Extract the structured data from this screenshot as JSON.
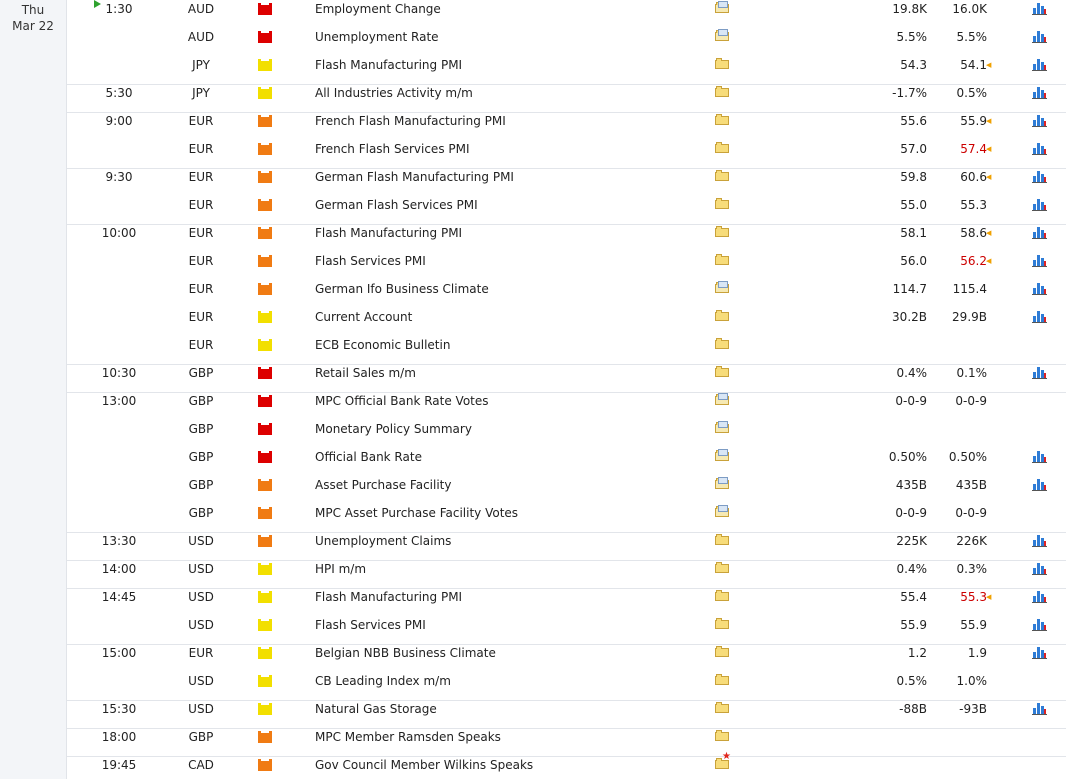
{
  "date": {
    "day": "Thu",
    "date": "Mar 22"
  },
  "rows": [
    {
      "time": "1:30",
      "currency": "AUD",
      "impact": "high",
      "event": "Employment Change",
      "detail": "note",
      "actual": "19.8K",
      "forecast": "16.0K",
      "forecast_revised": false,
      "arrow": "",
      "graph": true,
      "sep": false,
      "current": true
    },
    {
      "time": "",
      "currency": "AUD",
      "impact": "high",
      "event": "Unemployment Rate",
      "detail": "note",
      "actual": "5.5%",
      "forecast": "5.5%",
      "forecast_revised": false,
      "arrow": "",
      "graph": true,
      "sep": false
    },
    {
      "time": "",
      "currency": "JPY",
      "impact": "low",
      "event": "Flash Manufacturing PMI",
      "detail": "plain",
      "actual": "54.3",
      "forecast": "54.1",
      "forecast_revised": false,
      "arrow": "◀",
      "graph": true,
      "sep": false
    },
    {
      "time": "5:30",
      "currency": "JPY",
      "impact": "low",
      "event": "All Industries Activity m/m",
      "detail": "plain",
      "actual": "-1.7%",
      "forecast": "0.5%",
      "forecast_revised": false,
      "arrow": "",
      "graph": true,
      "sep": true
    },
    {
      "time": "9:00",
      "currency": "EUR",
      "impact": "medium",
      "event": "French Flash Manufacturing PMI",
      "detail": "plain",
      "actual": "55.6",
      "forecast": "55.9",
      "forecast_revised": false,
      "arrow": "◀",
      "graph": true,
      "sep": true
    },
    {
      "time": "",
      "currency": "EUR",
      "impact": "medium",
      "event": "French Flash Services PMI",
      "detail": "plain",
      "actual": "57.0",
      "forecast": "57.4",
      "forecast_revised": true,
      "arrow": "◀",
      "graph": true,
      "sep": false
    },
    {
      "time": "9:30",
      "currency": "EUR",
      "impact": "medium",
      "event": "German Flash Manufacturing PMI",
      "detail": "plain",
      "actual": "59.8",
      "forecast": "60.6",
      "forecast_revised": false,
      "arrow": "◀",
      "graph": true,
      "sep": true
    },
    {
      "time": "",
      "currency": "EUR",
      "impact": "medium",
      "event": "German Flash Services PMI",
      "detail": "plain",
      "actual": "55.0",
      "forecast": "55.3",
      "forecast_revised": false,
      "arrow": "",
      "graph": true,
      "sep": false
    },
    {
      "time": "10:00",
      "currency": "EUR",
      "impact": "medium",
      "event": "Flash Manufacturing PMI",
      "detail": "plain",
      "actual": "58.1",
      "forecast": "58.6",
      "forecast_revised": false,
      "arrow": "◀",
      "graph": true,
      "sep": true
    },
    {
      "time": "",
      "currency": "EUR",
      "impact": "medium",
      "event": "Flash Services PMI",
      "detail": "plain",
      "actual": "56.0",
      "forecast": "56.2",
      "forecast_revised": true,
      "arrow": "◀",
      "graph": true,
      "sep": false
    },
    {
      "time": "",
      "currency": "EUR",
      "impact": "medium",
      "event": "German Ifo Business Climate",
      "detail": "note",
      "actual": "114.7",
      "forecast": "115.4",
      "forecast_revised": false,
      "arrow": "",
      "graph": true,
      "sep": false
    },
    {
      "time": "",
      "currency": "EUR",
      "impact": "low",
      "event": "Current Account",
      "detail": "plain",
      "actual": "30.2B",
      "forecast": "29.9B",
      "forecast_revised": false,
      "arrow": "",
      "graph": true,
      "sep": false
    },
    {
      "time": "",
      "currency": "EUR",
      "impact": "low",
      "event": "ECB Economic Bulletin",
      "detail": "plain",
      "actual": "",
      "forecast": "",
      "forecast_revised": false,
      "arrow": "",
      "graph": false,
      "sep": false
    },
    {
      "time": "10:30",
      "currency": "GBP",
      "impact": "high",
      "event": "Retail Sales m/m",
      "detail": "plain",
      "actual": "0.4%",
      "forecast": "0.1%",
      "forecast_revised": false,
      "arrow": "",
      "graph": true,
      "sep": true
    },
    {
      "time": "13:00",
      "currency": "GBP",
      "impact": "high",
      "event": "MPC Official Bank Rate Votes",
      "detail": "note",
      "actual": "0-0-9",
      "forecast": "0-0-9",
      "forecast_revised": false,
      "arrow": "",
      "graph": false,
      "sep": true
    },
    {
      "time": "",
      "currency": "GBP",
      "impact": "high",
      "event": "Monetary Policy Summary",
      "detail": "note",
      "actual": "",
      "forecast": "",
      "forecast_revised": false,
      "arrow": "",
      "graph": false,
      "sep": false
    },
    {
      "time": "",
      "currency": "GBP",
      "impact": "high",
      "event": "Official Bank Rate",
      "detail": "note",
      "actual": "0.50%",
      "forecast": "0.50%",
      "forecast_revised": false,
      "arrow": "",
      "graph": true,
      "sep": false
    },
    {
      "time": "",
      "currency": "GBP",
      "impact": "medium",
      "event": "Asset Purchase Facility",
      "detail": "note",
      "actual": "435B",
      "forecast": "435B",
      "forecast_revised": false,
      "arrow": "",
      "graph": true,
      "sep": false
    },
    {
      "time": "",
      "currency": "GBP",
      "impact": "medium",
      "event": "MPC Asset Purchase Facility Votes",
      "detail": "note",
      "actual": "0-0-9",
      "forecast": "0-0-9",
      "forecast_revised": false,
      "arrow": "",
      "graph": false,
      "sep": false
    },
    {
      "time": "13:30",
      "currency": "USD",
      "impact": "medium",
      "event": "Unemployment Claims",
      "detail": "plain",
      "actual": "225K",
      "forecast": "226K",
      "forecast_revised": false,
      "arrow": "",
      "graph": true,
      "sep": true
    },
    {
      "time": "14:00",
      "currency": "USD",
      "impact": "low",
      "event": "HPI m/m",
      "detail": "plain",
      "actual": "0.4%",
      "forecast": "0.3%",
      "forecast_revised": false,
      "arrow": "",
      "graph": true,
      "sep": true
    },
    {
      "time": "14:45",
      "currency": "USD",
      "impact": "low",
      "event": "Flash Manufacturing PMI",
      "detail": "plain",
      "actual": "55.4",
      "forecast": "55.3",
      "forecast_revised": true,
      "arrow": "◀",
      "graph": true,
      "sep": true
    },
    {
      "time": "",
      "currency": "USD",
      "impact": "low",
      "event": "Flash Services PMI",
      "detail": "plain",
      "actual": "55.9",
      "forecast": "55.9",
      "forecast_revised": false,
      "arrow": "",
      "graph": true,
      "sep": false
    },
    {
      "time": "15:00",
      "currency": "EUR",
      "impact": "low",
      "event": "Belgian NBB Business Climate",
      "detail": "plain",
      "actual": "1.2",
      "forecast": "1.9",
      "forecast_revised": false,
      "arrow": "",
      "graph": true,
      "sep": true
    },
    {
      "time": "",
      "currency": "USD",
      "impact": "low",
      "event": "CB Leading Index m/m",
      "detail": "plain",
      "actual": "0.5%",
      "forecast": "1.0%",
      "forecast_revised": false,
      "arrow": "",
      "graph": false,
      "sep": false
    },
    {
      "time": "15:30",
      "currency": "USD",
      "impact": "low",
      "event": "Natural Gas Storage",
      "detail": "plain",
      "actual": "-88B",
      "forecast": "-93B",
      "forecast_revised": false,
      "arrow": "",
      "graph": true,
      "sep": true
    },
    {
      "time": "18:00",
      "currency": "GBP",
      "impact": "medium",
      "event": "MPC Member Ramsden Speaks",
      "detail": "plain",
      "actual": "",
      "forecast": "",
      "forecast_revised": false,
      "arrow": "",
      "graph": false,
      "sep": true
    },
    {
      "time": "19:45",
      "currency": "CAD",
      "impact": "medium",
      "event": "Gov Council Member Wilkins Speaks",
      "detail": "star",
      "actual": "",
      "forecast": "",
      "forecast_revised": false,
      "arrow": "",
      "graph": false,
      "sep": true
    }
  ],
  "colors": {
    "high": "#dd0000",
    "medium": "#f07b13",
    "low": "#f2df00",
    "revised": "#cc0000",
    "current": "#2ea22e"
  },
  "icons": {
    "impact": "folder-impact-icon",
    "detail": "folder-icon",
    "graph": "bar-graph-icon",
    "current": "play-icon",
    "arrow": "arrow-left-icon"
  }
}
